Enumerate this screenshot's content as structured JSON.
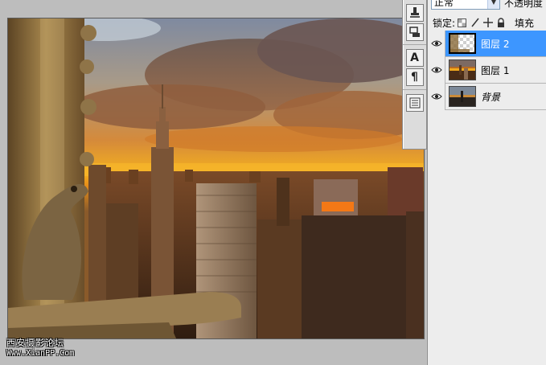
{
  "canvas": {
    "watermark_title": "西安摄影论坛",
    "watermark_url": "Www.XianPP.Com"
  },
  "tools": {
    "group1": [
      "clone-stamp-icon",
      "history-brush-icon"
    ],
    "group2": [
      "type-tool-icon",
      "paragraph-icon"
    ],
    "group3": [
      "layer-comps-icon"
    ],
    "type_glyph": "A",
    "paragraph_glyph": "¶"
  },
  "layers_panel": {
    "blend_mode": "正常",
    "opacity_label": "不透明度",
    "lock_label": "锁定:",
    "fill_label": "填充",
    "layers": [
      {
        "name": "图层 2",
        "selected": true,
        "visible": true,
        "thumb": "transparent-checker"
      },
      {
        "name": "图层 1",
        "selected": false,
        "visible": true,
        "thumb": "city-sunset"
      },
      {
        "name": "背景",
        "selected": false,
        "visible": true,
        "thumb": "city-dusk"
      }
    ]
  },
  "colors": {
    "selection_blue": "#3d96ff",
    "panel_bg": "#ededed",
    "workspace_gray": "#bdbdbd"
  }
}
